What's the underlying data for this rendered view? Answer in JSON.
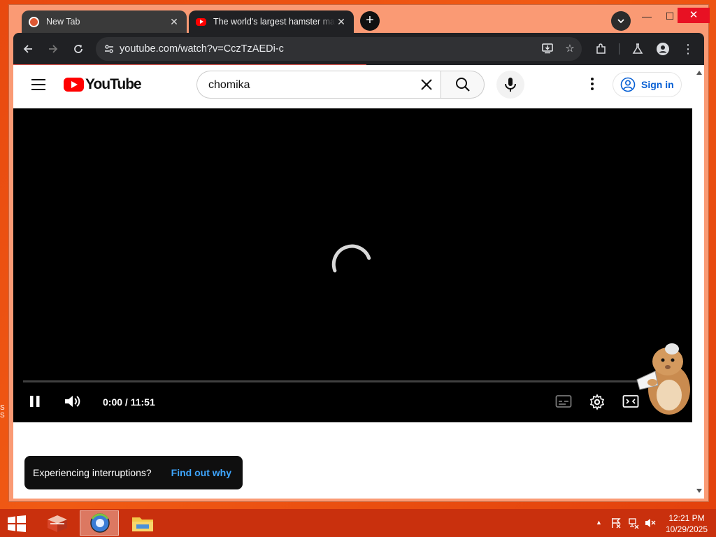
{
  "browser": {
    "tabs": [
      {
        "title": "New Tab",
        "favicon": "duckduckgo-icon"
      },
      {
        "title": "The world's largest hamster ma",
        "favicon": "youtube-icon"
      }
    ],
    "url": "youtube.com/watch?v=CczTzAEDi-c"
  },
  "youtube": {
    "logo_text": "YouTube",
    "search_value": "chomika",
    "sign_in_label": "Sign in"
  },
  "player": {
    "time_display": "0:00 / 11:51",
    "state": "loading"
  },
  "toast": {
    "message": "Experiencing interruptions?",
    "link_label": "Find out why"
  },
  "taskbar": {
    "clock_time": "12:21 PM",
    "clock_date": "10/29/2025"
  },
  "colors": {
    "youtube_red": "#ff0000",
    "link_blue": "#065fd4",
    "toast_link": "#3ea6ff",
    "desktop_orange": "#e8490f"
  }
}
